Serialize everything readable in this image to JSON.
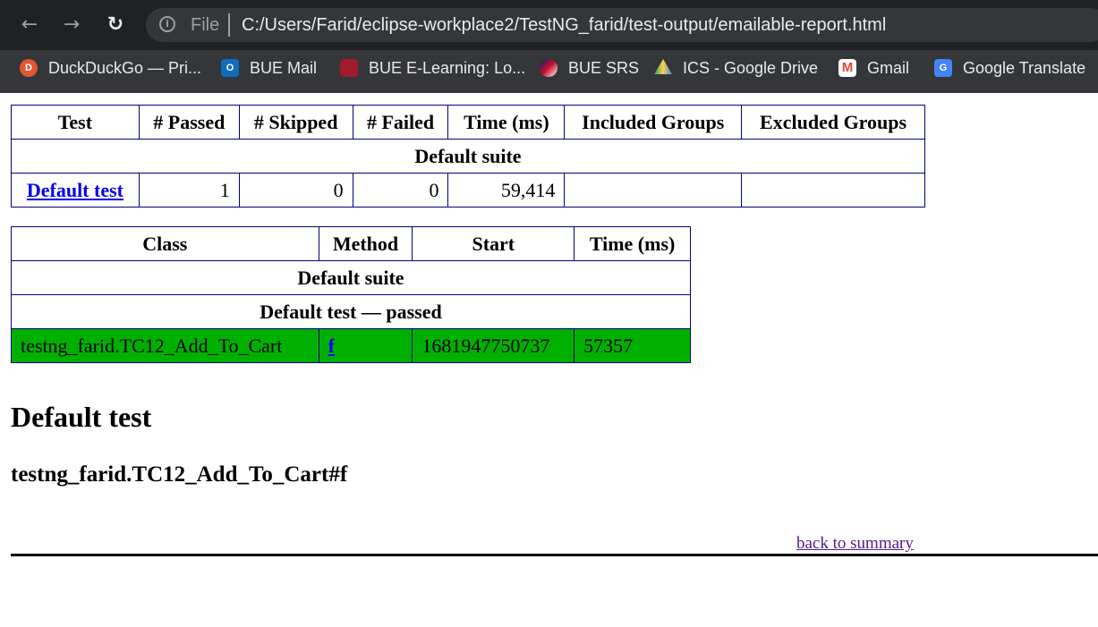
{
  "browser": {
    "file_label": "File",
    "url": "C:/Users/Farid/eclipse-workplace2/TestNG_farid/test-output/emailable-report.html",
    "bookmarks": [
      {
        "label": "DuckDuckGo — Pri...",
        "icon": "duckduckgo-icon",
        "color": "#de5833"
      },
      {
        "label": "BUE Mail",
        "icon": "outlook-icon",
        "color": "#0f6cbd"
      },
      {
        "label": "BUE E-Learning: Lo...",
        "icon": "bue-crest-icon",
        "color": "#a01c2c"
      },
      {
        "label": "BUE SRS",
        "icon": "uk-egypt-flag-icon",
        "color": "#c8102e"
      },
      {
        "label": "ICS - Google Drive",
        "icon": "google-drive-icon",
        "color": "#1fa463"
      },
      {
        "label": "Gmail",
        "icon": "gmail-icon",
        "color": "#ea4335"
      },
      {
        "label": "Google Translate",
        "icon": "google-translate-icon",
        "color": "#4285f4"
      }
    ]
  },
  "summary": {
    "headers": [
      "Test",
      "# Passed",
      "# Skipped",
      "# Failed",
      "Time (ms)",
      "Included Groups",
      "Excluded Groups"
    ],
    "suite": "Default suite",
    "row": {
      "test": "Default test",
      "passed": "1",
      "skipped": "0",
      "failed": "0",
      "time": "59,414",
      "included": "",
      "excluded": ""
    }
  },
  "details": {
    "headers": [
      "Class",
      "Method",
      "Start",
      "Time (ms)"
    ],
    "suite": "Default suite",
    "test_status": "Default test — passed",
    "row": {
      "class": "testng_farid.TC12_Add_To_Cart",
      "method": "f",
      "start": "1681947750737",
      "time": "57357"
    },
    "pass_color": "#00b000"
  },
  "section": {
    "title": "Default test",
    "method_title": "testng_farid.TC12_Add_To_Cart#f",
    "back_link": "back to summary"
  }
}
